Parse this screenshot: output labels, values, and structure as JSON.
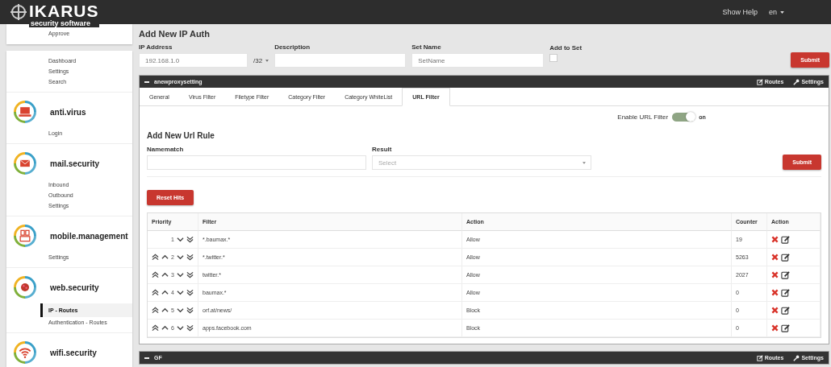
{
  "header": {
    "logo_title": "IKARUS",
    "logo_subtitle": "security software",
    "help": "Show Help",
    "language": "en"
  },
  "sidebar": {
    "groups": [
      {
        "items": [
          {
            "label": "Approve",
            "selected": false
          }
        ]
      },
      {
        "items": [
          {
            "label": "Dashboard",
            "selected": false
          },
          {
            "label": "Settings",
            "selected": false
          },
          {
            "label": "Search",
            "selected": false
          }
        ]
      },
      {
        "title": "anti.virus",
        "kind": "laptop",
        "items": [
          {
            "label": "Login",
            "selected": false
          }
        ]
      },
      {
        "title": "mail.security",
        "kind": "mail",
        "items": [
          {
            "label": "Inbound",
            "selected": false
          },
          {
            "label": "Outbound",
            "selected": false
          },
          {
            "label": "Settings",
            "selected": false
          }
        ]
      },
      {
        "title": "mobile.management",
        "kind": "mobile",
        "items": [
          {
            "label": "Settings",
            "selected": false
          }
        ]
      },
      {
        "title": "web.security",
        "kind": "web",
        "items": [
          {
            "label": "IP - Routes",
            "selected": true
          },
          {
            "label": "Authentication - Routes",
            "selected": false
          }
        ]
      },
      {
        "title": "wifi.security",
        "kind": "wifi"
      }
    ]
  },
  "ip_auth": {
    "title": "Add New IP Auth",
    "ip_label": "IP Address",
    "ip_placeholder": "192.168.1.0",
    "mask": "/32",
    "description_label": "Description",
    "set_name_label": "Set Name",
    "set_name_placeholder": "SetName",
    "add_to_set_label": "Add to Set",
    "add_to_set_checked": false,
    "submit": "Submit"
  },
  "proxy_panel": {
    "title": "anewproxysetting",
    "links": [
      "Routes",
      "Settings"
    ],
    "tabs": [
      {
        "label": "General",
        "selected": false
      },
      {
        "label": "Virus Filter",
        "selected": false
      },
      {
        "label": "Filetype Filter",
        "selected": false
      },
      {
        "label": "Category Filter",
        "selected": false
      },
      {
        "label": "Category WhiteList",
        "selected": false
      },
      {
        "label": "URL Filter",
        "selected": true
      }
    ],
    "enable_label": "Enable URL Filter",
    "enable_on": true,
    "enable_state": "on",
    "rule_title": "Add New Url Rule",
    "namematch_label": "Namematch",
    "result_label": "Result",
    "result_placeholder": "Select",
    "submit": "Submit",
    "reset": "Reset Hits",
    "columns": [
      "Priority",
      "Filter",
      "Action",
      "Counter",
      "Action"
    ],
    "rows": [
      {
        "priority": "1",
        "can_move_up": false,
        "filter": "*.baumax.*",
        "action": "Allow",
        "counter": "19"
      },
      {
        "priority": "2",
        "can_move_up": true,
        "filter": "*.twitter.*",
        "action": "Allow",
        "counter": "5263"
      },
      {
        "priority": "3",
        "can_move_up": true,
        "filter": "twitter.*",
        "action": "Allow",
        "counter": "2027"
      },
      {
        "priority": "4",
        "can_move_up": true,
        "filter": "baumax.*",
        "action": "Allow",
        "counter": "0"
      },
      {
        "priority": "5",
        "can_move_up": true,
        "filter": "orf.at/news/",
        "action": "Block",
        "counter": "0"
      },
      {
        "priority": "6",
        "can_move_up": true,
        "filter": "apps.facebook.com",
        "action": "Block",
        "counter": "0"
      }
    ]
  },
  "gf_panel": {
    "title": "GF",
    "links": [
      "Routes",
      "Settings"
    ]
  }
}
